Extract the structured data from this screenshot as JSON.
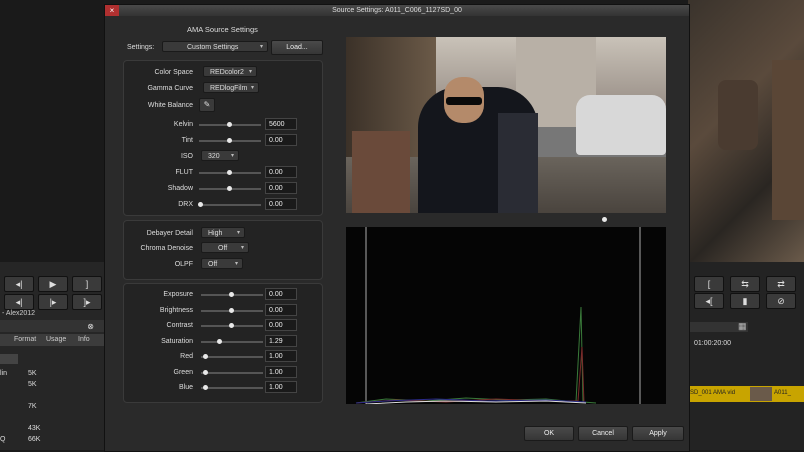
{
  "dialog": {
    "title": "Source Settings: A011_C006_1127SD_00",
    "close": "×",
    "section_title": "AMA Source Settings",
    "settings_label": "Settings:",
    "settings_value": "Custom Settings",
    "load_label": "Load...",
    "color_space_label": "Color Space",
    "color_space_value": "REDcolor2",
    "gamma_curve_label": "Gamma Curve",
    "gamma_curve_value": "REDlogFilm",
    "white_balance_label": "White Balance",
    "kelvin_label": "Kelvin",
    "kelvin_value": "5600",
    "tint_label": "Tint",
    "tint_value": "0.00",
    "iso_label": "ISO",
    "iso_value": "320",
    "flut_label": "FLUT",
    "flut_value": "0.00",
    "shadow_label": "Shadow",
    "shadow_value": "0.00",
    "drx_label": "DRX",
    "drx_value": "0.00",
    "debayer_label": "Debayer Detail",
    "debayer_value": "High",
    "chroma_label": "Chroma Denoise",
    "chroma_value": "Off",
    "olpf_label": "OLPF",
    "olpf_value": "Off",
    "exposure_label": "Exposure",
    "exposure_value": "0.00",
    "brightness_label": "Brightness",
    "brightness_value": "0.00",
    "contrast_label": "Contrast",
    "contrast_value": "0.00",
    "saturation_label": "Saturation",
    "saturation_value": "1.29",
    "red_label": "Red",
    "red_value": "1.00",
    "green_label": "Green",
    "green_value": "1.00",
    "blue_label": "Blue",
    "blue_value": "1.00",
    "ok_label": "OK",
    "cancel_label": "Cancel",
    "apply_label": "Apply"
  },
  "background": {
    "bin_name": "- Alex2012",
    "columns": [
      "Format",
      "Usage",
      "Info"
    ],
    "rows": [
      {
        "label": "lin",
        "size": "5K"
      },
      {
        "label": "",
        "size": "5K"
      },
      {
        "label": "",
        "size": "7K"
      },
      {
        "label": "",
        "size": "43K"
      },
      {
        "label": "Q",
        "size": "66K"
      }
    ],
    "timecode": "01:00:20:00",
    "clip_name": "SD_001 AMA vid",
    "clip_name2": "A011_"
  },
  "colors": {
    "accent_clip": "#c8a400",
    "close_red": "#b03030"
  }
}
